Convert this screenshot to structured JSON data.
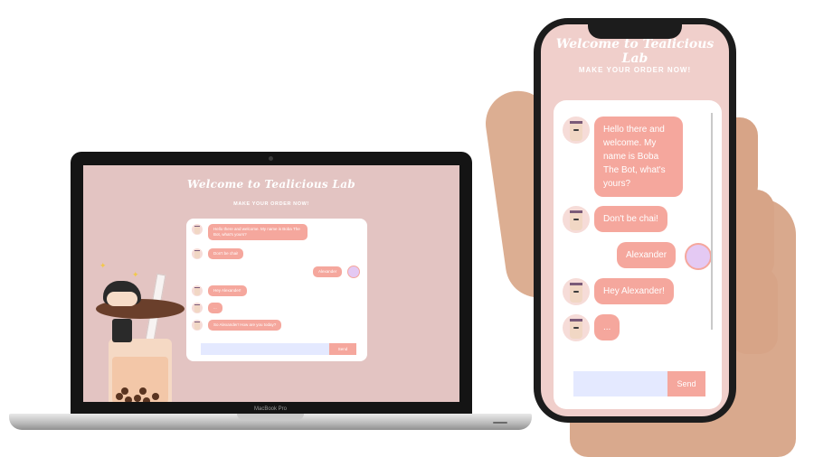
{
  "brand": {
    "title": "Welcome to Tealicious Lab",
    "subtitle": "MAKE YOUR ORDER NOW!"
  },
  "laptop": {
    "model_label": "MacBook Pro",
    "messages": [
      {
        "sender": "bot",
        "text": "Hello there and welcome. My name is Boba The Bot, what's yours?"
      },
      {
        "sender": "bot",
        "text": "Don't be chai!"
      },
      {
        "sender": "user",
        "text": "Alexander"
      },
      {
        "sender": "bot",
        "text": "Hey Alexander!"
      },
      {
        "sender": "bot",
        "text": "..."
      },
      {
        "sender": "bot",
        "text": "So Alexander! How are you today?"
      }
    ],
    "input_placeholder": "",
    "send_label": "Send"
  },
  "phone": {
    "messages": [
      {
        "sender": "bot",
        "text": "Hello there and welcome. My name is Boba The Bot, what's yours?"
      },
      {
        "sender": "bot",
        "text": "Don't be chai!"
      },
      {
        "sender": "user",
        "text": "Alexander"
      },
      {
        "sender": "bot",
        "text": "Hey Alexander!"
      },
      {
        "sender": "bot",
        "text": "..."
      }
    ],
    "input_placeholder": "",
    "send_label": "Send"
  },
  "colors": {
    "page_bg": "#e3c4c2",
    "bubble": "#f5a79d",
    "chat_panel": "#ffffff",
    "input": "#e4e9ff",
    "text_light": "#ffffff"
  }
}
